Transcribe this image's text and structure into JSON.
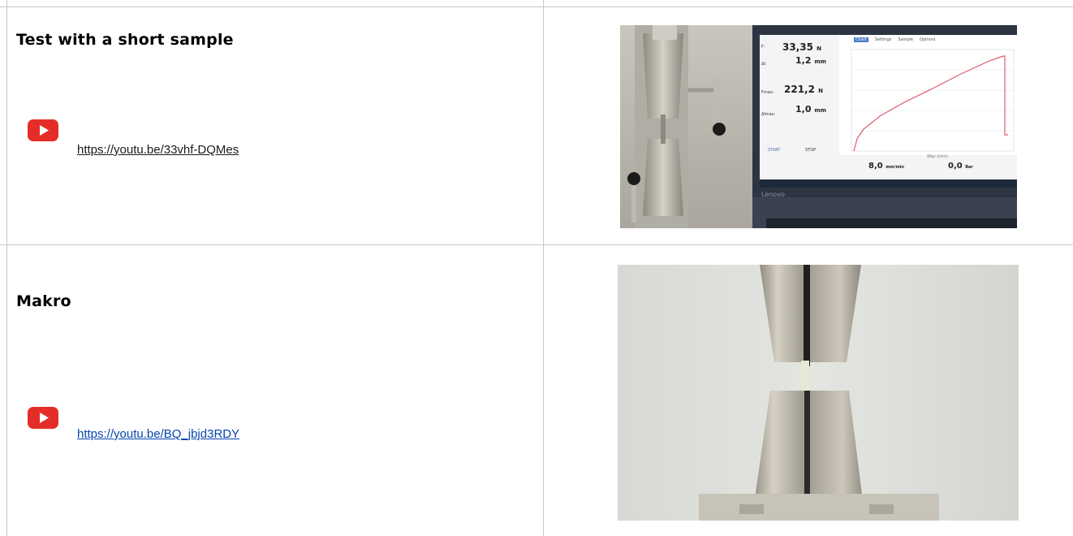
{
  "rows": [
    {
      "title": "Test with a short sample",
      "link": "https://youtu.be/33vhf-DQMes",
      "link_color": "#1a1a1a",
      "screen": {
        "tabs": [
          "Chart",
          "Settings",
          "Sample",
          "Options"
        ],
        "readouts": [
          {
            "label": "F:",
            "value": "33,35",
            "unit": "N"
          },
          {
            "label": "Δl:",
            "value": "1,2",
            "unit": "mm"
          },
          {
            "label": "Fmax:",
            "value": "221,2",
            "unit": "N"
          },
          {
            "label": "Δlmax:",
            "value": "1,0",
            "unit": "mm"
          }
        ],
        "buttons": [
          "START",
          "STOP"
        ],
        "bottom_readouts": [
          {
            "value": "8,0",
            "unit": "mm/min"
          },
          {
            "value": "0,0",
            "unit": "Bar"
          }
        ],
        "x_label": "Way (mm)",
        "laptop_brand": "Lenovo"
      }
    },
    {
      "title": "Makro",
      "link": "https://youtu.be/BQ_jbjd3RDY",
      "link_color": "#0645ad"
    }
  ],
  "colors": {
    "youtube_red": "#e52d27",
    "grid": "#c8c8c8"
  }
}
